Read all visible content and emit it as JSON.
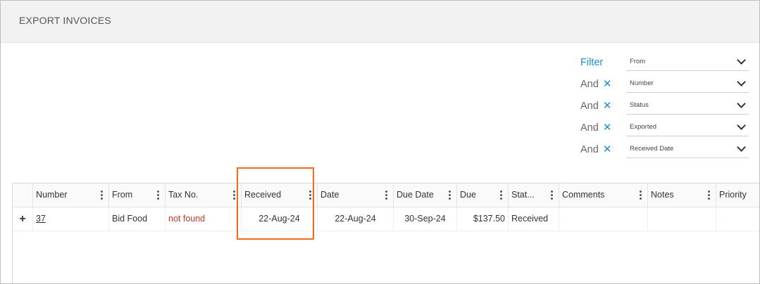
{
  "header": {
    "title": "EXPORT INVOICES"
  },
  "filters": {
    "rows": [
      {
        "label": "Filter",
        "removable": false,
        "field": "From"
      },
      {
        "label": "And",
        "removable": true,
        "field": "Number"
      },
      {
        "label": "And",
        "removable": true,
        "field": "Status"
      },
      {
        "label": "And",
        "removable": true,
        "field": "Exported"
      },
      {
        "label": "And",
        "removable": true,
        "field": "Received Date"
      }
    ],
    "remove_glyph": "✕"
  },
  "grid": {
    "columns": [
      "Number",
      "From",
      "Tax No.",
      "Received",
      "Date",
      "Due Date",
      "Due",
      "Stat...",
      "Comments",
      "Notes",
      "Priority"
    ],
    "rows": [
      {
        "expand": "+",
        "number": "37",
        "from": "Bid Food",
        "tax_no": "not found",
        "received": "22-Aug-24",
        "date": "22-Aug-24",
        "due_date": "30-Sep-24",
        "due": "$137.50",
        "status": "Received",
        "comments": "",
        "notes": "",
        "priority": ""
      }
    ]
  },
  "colors": {
    "accent": "#1a8fd1",
    "highlight": "#f26a1b",
    "error_text": "#c0392b"
  }
}
